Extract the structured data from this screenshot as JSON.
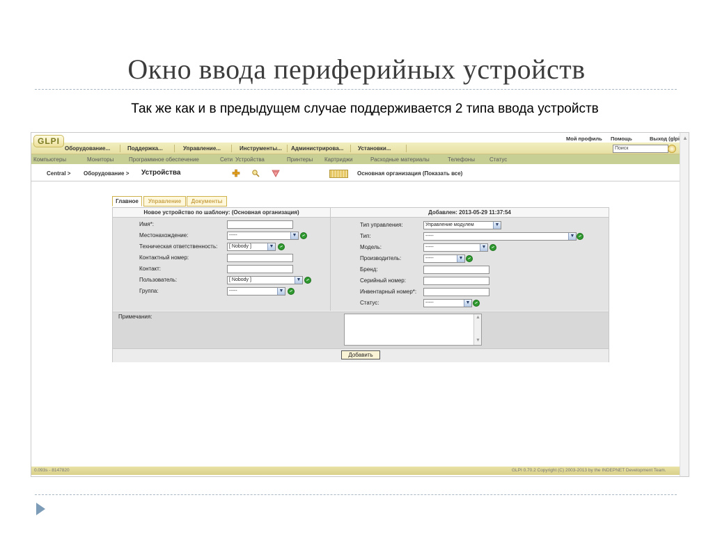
{
  "slide": {
    "title": "Окно ввода периферийных устройств",
    "subtitle": "Так же как и в предыдущем случае поддерживается 2 типа ввода устройств"
  },
  "app": {
    "logo": "GLPI",
    "top_links": [
      "Мой профиль",
      "Помощь",
      "Выход (glpi)"
    ],
    "search_placeholder": "Поиск",
    "main_menu": [
      "Оборудование...",
      "Поддержка...",
      "Управление...",
      "Инструменты...",
      "Администрирова...",
      "Установки..."
    ],
    "sub_menu": [
      "Компьютеры",
      "Мониторы",
      "Программное обеспечение",
      "Сети",
      "Устройства",
      "Принтеры",
      "Картриджи",
      "Расходные материалы",
      "Телефоны",
      "Статус"
    ],
    "breadcrumb": [
      "Central >",
      "Оборудование >"
    ],
    "breadcrumb_current": "Устройства",
    "entity": "Основная организация (Показать все)"
  },
  "tabs": [
    "Главное",
    "Управление",
    "Документы"
  ],
  "form": {
    "left_header": "Новое устройство по шаблону: (Основная организация)",
    "right_header": "Добавлен: 2013-05-29 11:37:54",
    "left_fields": [
      {
        "label": "Имя*:",
        "value": ""
      },
      {
        "label": "Местонахождение:",
        "value": "-----"
      },
      {
        "label": "Техническая ответственность:",
        "value": "[ Nobody ]"
      },
      {
        "label": "Контактный номер:",
        "value": ""
      },
      {
        "label": "Контакт:",
        "value": ""
      },
      {
        "label": "Пользователь:",
        "value": "[ Nobody ]"
      },
      {
        "label": "Группа:",
        "value": "-----"
      }
    ],
    "right_fields": [
      {
        "label": "Тип управления:",
        "value": "Управление модулем"
      },
      {
        "label": "Тип:",
        "value": "-----"
      },
      {
        "label": "Модель:",
        "value": "-----"
      },
      {
        "label": "Производитель:",
        "value": "-----"
      },
      {
        "label": "Бренд:",
        "value": ""
      },
      {
        "label": "Серийный номер:",
        "value": ""
      },
      {
        "label": "Инвентарный номер*:",
        "value": ""
      },
      {
        "label": "Статус:",
        "value": "-----"
      }
    ],
    "notes_label": "Примечания:",
    "add_button": "Добавить"
  },
  "footer": {
    "left": "0.093s - 8147820",
    "right": "GLPI 0.70.2 Copyright (C) 2003-2013 by the INDEPNET Development Team."
  },
  "colors": {
    "menu_bar": "#e7e0a4",
    "submenu_bar": "#c8cf95",
    "accent_icon": "#2f9a2f"
  },
  "icons": [
    "plus-icon",
    "search-icon",
    "template-icon",
    "entity-icon",
    "dropdown-arrow-icon",
    "add-item-icon",
    "scroll-up-icon"
  ]
}
